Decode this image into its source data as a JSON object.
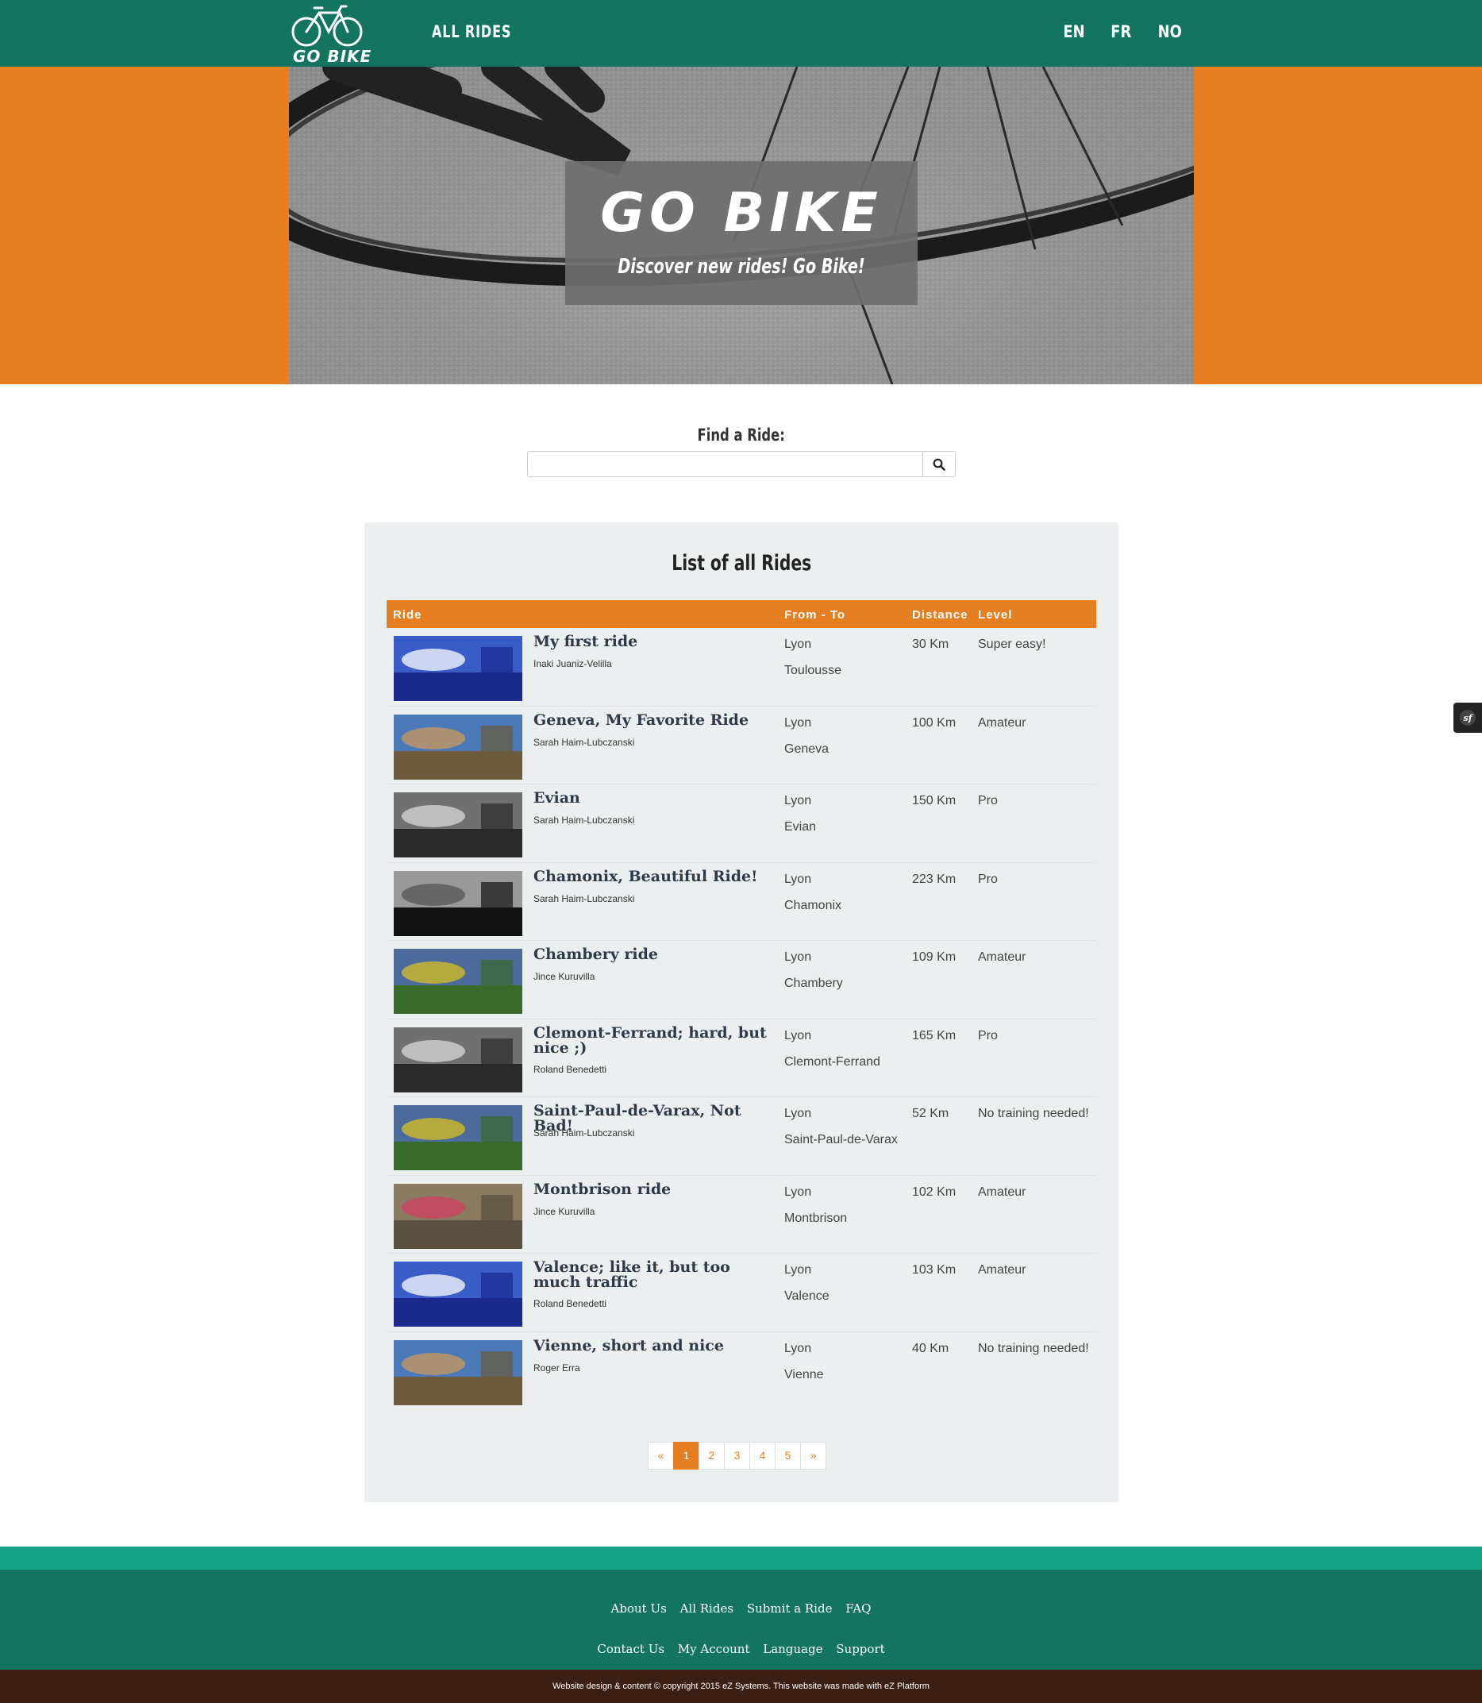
{
  "header": {
    "logo_text": "GO BIKE",
    "nav_all_rides": "ALL RIDES",
    "languages": [
      "EN",
      "FR",
      "NO"
    ]
  },
  "hero": {
    "title": "GO BIKE",
    "subtitle": "Discover new rides! Go Bike!"
  },
  "search": {
    "label": "Find a Ride:",
    "value": "",
    "placeholder": "",
    "icon": "search-icon"
  },
  "list": {
    "title": "List of all Rides",
    "columns": [
      "Ride",
      "From - To",
      "Distance",
      "Level"
    ],
    "rows": [
      {
        "name": "My first ride",
        "author": "Inaki Juaniz-Velilla",
        "from": "Lyon",
        "to": "Toulousse",
        "distance": "30 Km",
        "level": "Super easy!"
      },
      {
        "name": "Geneva, My Favorite Ride",
        "author": "Sarah Haim-Lubczanski",
        "from": "Lyon",
        "to": "Geneva",
        "distance": "100 Km",
        "level": "Amateur"
      },
      {
        "name": "Evian",
        "author": "Sarah Haim-Lubczanski",
        "from": "Lyon",
        "to": "Evian",
        "distance": "150 Km",
        "level": "Pro"
      },
      {
        "name": "Chamonix, Beautiful Ride!",
        "author": "Sarah Haim-Lubczanski",
        "from": "Lyon",
        "to": "Chamonix",
        "distance": "223 Km",
        "level": "Pro"
      },
      {
        "name": "Chambery ride",
        "author": "Jince Kuruvilla",
        "from": "Lyon",
        "to": "Chambery",
        "distance": "109 Km",
        "level": "Amateur"
      },
      {
        "name": "Clemont-Ferrand; hard, but nice ;)",
        "author": "Roland Benedetti",
        "from": "Lyon",
        "to": "Clemont-Ferrand",
        "distance": "165 Km",
        "level": "Pro"
      },
      {
        "name": "Saint-Paul-de-Varax, Not Bad!",
        "author": "Sarah Haim-Lubczanski",
        "from": "Lyon",
        "to": "Saint-Paul-de-Varax",
        "distance": "52 Km",
        "level": "No training needed!"
      },
      {
        "name": "Montbrison ride",
        "author": "Jince Kuruvilla",
        "from": "Lyon",
        "to": "Montbrison",
        "distance": "102 Km",
        "level": "Amateur"
      },
      {
        "name": "Valence; like it, but too much traffic",
        "author": "Roland Benedetti",
        "from": "Lyon",
        "to": "Valence",
        "distance": "103 Km",
        "level": "Amateur"
      },
      {
        "name": "Vienne, short and nice",
        "author": "Roger Erra",
        "from": "Lyon",
        "to": "Vienne",
        "distance": "40 Km",
        "level": "No training needed!"
      }
    ]
  },
  "pagination": {
    "prev": "«",
    "pages": [
      "1",
      "2",
      "3",
      "4",
      "5"
    ],
    "active": "1",
    "next": "»"
  },
  "footer": {
    "links_row1": [
      "About Us",
      "All Rides",
      "Submit a Ride",
      "FAQ"
    ],
    "links_row2": [
      "Contact Us",
      "My Account",
      "Language",
      "Support"
    ],
    "copyright": "Website design & content © copyright 2015 eZ Systems. This website was made with eZ Platform"
  },
  "colors": {
    "header": "#137460",
    "accent": "#e67e22",
    "footer_strip": "#16a085",
    "copyright_bar": "#3a1f12"
  }
}
